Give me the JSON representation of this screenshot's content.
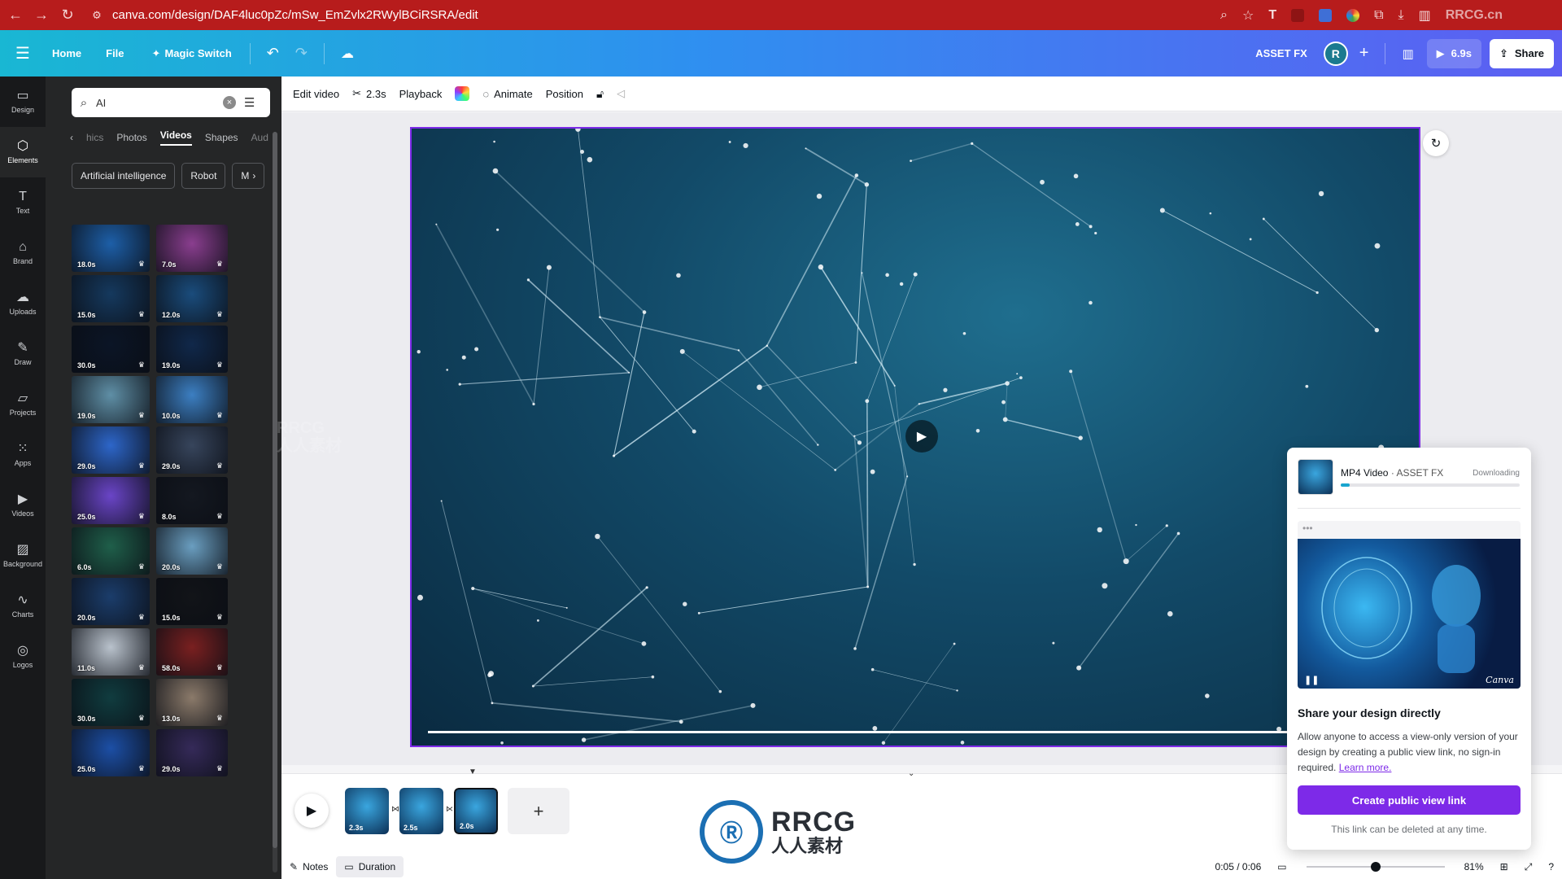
{
  "browser": {
    "url": "canva.com/design/DAF4luc0pZc/mSw_EmZvlx2RWylBCiRSRA/edit",
    "watermark": "RRCG.cn"
  },
  "header": {
    "home": "Home",
    "file": "File",
    "magic_switch": "Magic Switch",
    "project_name": "ASSET FX",
    "avatar_initial": "R",
    "play_duration": "6.9s",
    "share": "Share"
  },
  "left_rail": [
    {
      "label": "Design",
      "icon": "design-icon",
      "glyph": "▭"
    },
    {
      "label": "Elements",
      "icon": "elements-icon",
      "glyph": "⬡"
    },
    {
      "label": "Text",
      "icon": "text-icon",
      "glyph": "T"
    },
    {
      "label": "Brand",
      "icon": "brand-icon",
      "glyph": "⌂"
    },
    {
      "label": "Uploads",
      "icon": "uploads-icon",
      "glyph": "☁"
    },
    {
      "label": "Draw",
      "icon": "draw-icon",
      "glyph": "✎"
    },
    {
      "label": "Projects",
      "icon": "projects-icon",
      "glyph": "▱"
    },
    {
      "label": "Apps",
      "icon": "apps-icon",
      "glyph": "⁙"
    },
    {
      "label": "Videos",
      "icon": "videos-icon",
      "glyph": "▶"
    },
    {
      "label": "Background",
      "icon": "background-icon",
      "glyph": "▨"
    },
    {
      "label": "Charts",
      "icon": "charts-icon",
      "glyph": "∿"
    },
    {
      "label": "Logos",
      "icon": "logos-icon",
      "glyph": "◎"
    }
  ],
  "side_panel": {
    "search_value": "AI",
    "tabs": [
      "hics",
      "Photos",
      "Videos",
      "Shapes",
      "Aud"
    ],
    "active_tab": "Videos",
    "chips": [
      "Artificial intelligence",
      "Robot",
      "M"
    ],
    "thumbnails": [
      {
        "duration": "18.0s",
        "color": "#1d5fa8"
      },
      {
        "duration": "7.0s",
        "color": "#8a3e8f"
      },
      {
        "duration": "15.0s",
        "color": "#15395e"
      },
      {
        "duration": "12.0s",
        "color": "#1a4c7c"
      },
      {
        "duration": "30.0s",
        "color": "#0b1526"
      },
      {
        "duration": "19.0s",
        "color": "#10284a"
      },
      {
        "duration": "19.0s",
        "color": "#5f8fa6"
      },
      {
        "duration": "10.0s",
        "color": "#3c7fc2"
      },
      {
        "duration": "29.0s",
        "color": "#2d66c9"
      },
      {
        "duration": "29.0s",
        "color": "#37455c"
      },
      {
        "duration": "25.0s",
        "color": "#6a45c7"
      },
      {
        "duration": "8.0s",
        "color": "#141820"
      },
      {
        "duration": "6.0s",
        "color": "#1f5f4a"
      },
      {
        "duration": "20.0s",
        "color": "#6a9ec0"
      },
      {
        "duration": "20.0s",
        "color": "#1b3d6b"
      },
      {
        "duration": "15.0s",
        "color": "#121418"
      },
      {
        "duration": "11.0s",
        "color": "#b9c2cc"
      },
      {
        "duration": "58.0s",
        "color": "#7a2020"
      },
      {
        "duration": "30.0s",
        "color": "#103c3f"
      },
      {
        "duration": "13.0s",
        "color": "#8b7a6a"
      },
      {
        "duration": "25.0s",
        "color": "#1c4fa6"
      },
      {
        "duration": "29.0s",
        "color": "#352a59"
      }
    ]
  },
  "toolbar": {
    "edit_video": "Edit video",
    "trim": "2.3s",
    "playback": "Playback",
    "animate": "Animate",
    "position": "Position"
  },
  "timeline": {
    "clips": [
      {
        "duration": "2.3s"
      },
      {
        "duration": "2.5s"
      },
      {
        "duration": "2.0s"
      }
    ],
    "add_page": "+"
  },
  "footer": {
    "notes": "Notes",
    "duration": "Duration",
    "time": "0:05 / 0:06",
    "zoom": "81%",
    "zoom_fraction": 0.5
  },
  "download_panel": {
    "title": "MP4 Video",
    "subtitle": "ASSET FX",
    "status": "Downloading",
    "progress": 0.05,
    "preview_brand": "Canva",
    "share_heading": "Share your design directly",
    "share_desc": "Allow anyone to access a view-only version of your design by creating a public view link, no sign-in required.",
    "learn_more": "Learn more.",
    "create_button": "Create public view link",
    "delete_note": "This link can be deleted at any time."
  },
  "watermark": {
    "logo_line1": "RRCG",
    "logo_line2": "人人素材",
    "badge": "RRCG",
    "badge_sub": "人人素材"
  },
  "colors": {
    "accent_purple": "#7d2ae8",
    "browser_red": "#b71c1c",
    "header_gradient_start": "#19b7d3",
    "header_gradient_end": "#5d5ef2"
  }
}
